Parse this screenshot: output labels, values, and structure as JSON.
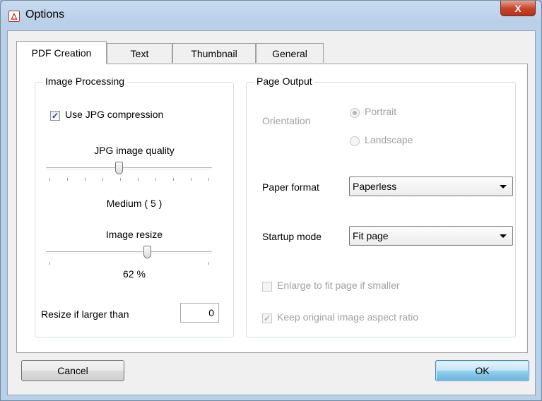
{
  "window": {
    "title": "Options",
    "close_label": "X"
  },
  "tabs": [
    {
      "label": "PDF Creation",
      "active": true
    },
    {
      "label": "Text",
      "active": false
    },
    {
      "label": "Thumbnail",
      "active": false
    },
    {
      "label": "General",
      "active": false
    }
  ],
  "image_processing": {
    "group_label": "Image Processing",
    "use_jpg": {
      "label": "Use JPG compression",
      "checked": true
    },
    "jpg_quality": {
      "label": "JPG image quality",
      "value_text": "Medium ( 5 )",
      "level": 0.45
    },
    "image_resize": {
      "label": "Image resize",
      "value_text": "62 %",
      "level": 0.62
    },
    "resize_if_larger": {
      "label": "Resize if larger than",
      "value": "0"
    }
  },
  "page_output": {
    "group_label": "Page Output",
    "orientation": {
      "label": "Orientation",
      "options": [
        "Portrait",
        "Landscape"
      ],
      "selected": "Portrait"
    },
    "paper_format": {
      "label": "Paper format",
      "value": "Paperless"
    },
    "startup_mode": {
      "label": "Startup mode",
      "value": "Fit page"
    },
    "enlarge": {
      "label": "Enlarge to fit page if smaller",
      "checked": false
    },
    "keep_aspect": {
      "label": "Keep original image aspect ratio",
      "checked": true
    }
  },
  "buttons": {
    "cancel": "Cancel",
    "ok": "OK"
  }
}
